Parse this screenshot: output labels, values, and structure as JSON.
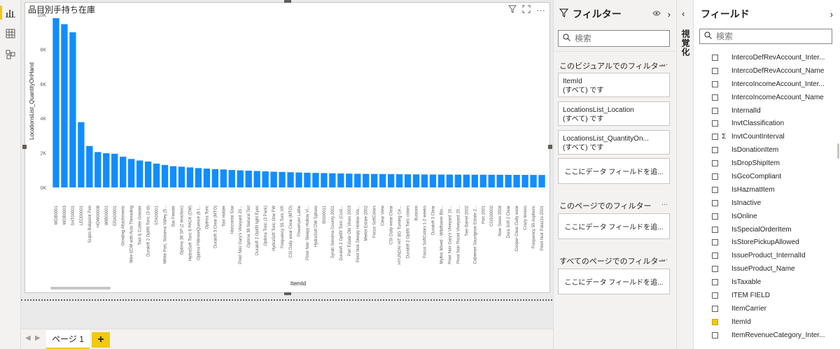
{
  "visual": {
    "title": "品目別手持ち在庫",
    "icons": [
      "filter-icon",
      "focus-icon",
      "more-icon"
    ]
  },
  "chart_data": {
    "type": "bar",
    "xlabel": "ItemId",
    "ylabel": "LocationsList_QuantityOnHand",
    "ylim": [
      0,
      10000
    ],
    "yticks": [
      "0K",
      "2K",
      "4K",
      "6K",
      "8K",
      "10K"
    ],
    "bar_color": "#118dff",
    "categories": [
      "WDB0001",
      "WDB0003",
      "SHT00001",
      "LED00001",
      "Sciplo Ballpoint Pen",
      "HDW00008",
      "WIB00001",
      "ERA00001",
      "Grinding Attachments",
      "Wire EDM with Auto Threading",
      "Tool & Cutter Grinder",
      "Duraloft 2 Optifit Toric (3 di)",
      "STA00001",
      "White Port, Sonoma Valley (5...",
      "Bar Feeder",
      "Optima 38 SP (2 lens/box)",
      "HydraSoft Toric 6 PACK (DW)",
      "Optima FW/oneQuence (6 l...",
      "Optima Toric",
      "Duraloft 3 Clear (MTO)",
      "Tool Holder",
      "Horizontal Saw",
      "Pinot Noir Gary's Vineyard 20...",
      "Optima 38 Natural Tint",
      "Duraloft 2 Optifit light Eyes",
      "Optima Toric (3 Pack)",
      "HydraSoft Toric One FW",
      "Frequency 55 Toric XR",
      "CSI Daily wear Clear (MTO)",
      "Powerturn Lathe",
      "Pinot Noir Sleepy Hollow Vi...",
      "HydraSoft DW Sphere",
      "BIS00011",
      "Syrah Sonoma County 2001",
      "Duraloft 2 Optifit Toric (Cust...",
      "Port Estate Old Vines 2003",
      "Pinot Noir Sleepy Hollow Vin...",
      "Merlot Estate 2002",
      "Focus SoftColors",
      "Clear View",
      "CSI Daily wear Clear",
      "HYUNDAI HiT BG Turning Ce...",
      "Duraloft 2 Optifit Toric colors",
      "Illusions",
      "Focus SoftColors 1-2 weeks",
      "Duraloft 3 Clear",
      "Mythic Mixed - Wildflower Blo...",
      "Pinot Noir Gary's Vineyard 19...",
      "Pinot Noir Pisoni Vineyard 20...",
      "Two Barrel 2002",
      "Cabernet Sauvignon Estate 2...",
      "Port 2001",
      "COS00002",
      "Now Sown 2004",
      "Dura Soft 2 Clear",
      "Cooper Clear Daily wear",
      "Crazy lenses",
      "Frequency 55 Aspheric",
      "Pinot Noir Palazzo 2001"
    ],
    "values": [
      9800,
      9450,
      8980,
      3780,
      2400,
      2050,
      1980,
      1950,
      1780,
      1650,
      1560,
      1500,
      1380,
      1300,
      1230,
      1200,
      1160,
      1120,
      1090,
      1060,
      1040,
      1010,
      990,
      970,
      950,
      930,
      910,
      895,
      880,
      865,
      850,
      840,
      830,
      820,
      810,
      800,
      790,
      785,
      780,
      775,
      770,
      765,
      760,
      755,
      750,
      748,
      746,
      744,
      742,
      740,
      738,
      736,
      734,
      732,
      730,
      728,
      726,
      724,
      722
    ]
  },
  "pages": {
    "tab_label": "ページ 1",
    "add_label": "+"
  },
  "filters": {
    "title": "フィルター",
    "search_placeholder": "検索",
    "visual_section": "このビジュアルでのフィルター",
    "page_section": "このページでのフィルター",
    "all_section": "すべてのページでのフィルター",
    "more": "...",
    "cards": [
      {
        "field": "ItemId",
        "state": "(すべて) です"
      },
      {
        "field": "LocationsList_Location",
        "state": "(すべて) です"
      },
      {
        "field": "LocationsList_QuantityOn...",
        "state": "(すべて) です"
      }
    ],
    "drop_label": "ここにデータ フィールドを追..."
  },
  "visualizations": {
    "label": "視覚化"
  },
  "fields": {
    "title": "フィールド",
    "search_placeholder": "検索",
    "items": [
      {
        "name": "IntercoDefRevAccount_Inter...",
        "checked": false,
        "sigma": false
      },
      {
        "name": "IntercoDefRevAccount_Name",
        "checked": false,
        "sigma": false
      },
      {
        "name": "IntercoIncomeAccount_Inter...",
        "checked": false,
        "sigma": false
      },
      {
        "name": "IntercoIncomeAccount_Name",
        "checked": false,
        "sigma": false
      },
      {
        "name": "InternalId",
        "checked": false,
        "sigma": false
      },
      {
        "name": "InvtClassification",
        "checked": false,
        "sigma": false
      },
      {
        "name": "InvtCountInterval",
        "checked": false,
        "sigma": true
      },
      {
        "name": "IsDonationItem",
        "checked": false,
        "sigma": false
      },
      {
        "name": "IsDropShipItem",
        "checked": false,
        "sigma": false
      },
      {
        "name": "IsGcoCompliant",
        "checked": false,
        "sigma": false
      },
      {
        "name": "IsHazmatItem",
        "checked": false,
        "sigma": false
      },
      {
        "name": "IsInactive",
        "checked": false,
        "sigma": false
      },
      {
        "name": "IsOnline",
        "checked": false,
        "sigma": false
      },
      {
        "name": "IsSpecialOrderItem",
        "checked": false,
        "sigma": false
      },
      {
        "name": "IsStorePickupAllowed",
        "checked": false,
        "sigma": false
      },
      {
        "name": "IssueProduct_InternalId",
        "checked": false,
        "sigma": false
      },
      {
        "name": "IssueProduct_Name",
        "checked": false,
        "sigma": false
      },
      {
        "name": "IsTaxable",
        "checked": false,
        "sigma": false
      },
      {
        "name": "ITEM FIELD",
        "checked": false,
        "sigma": false
      },
      {
        "name": "ItemCarrier",
        "checked": false,
        "sigma": false
      },
      {
        "name": "ItemId",
        "checked": true,
        "sigma": false
      },
      {
        "name": "ItemRevenueCategory_Inter...",
        "checked": false,
        "sigma": false
      }
    ]
  }
}
